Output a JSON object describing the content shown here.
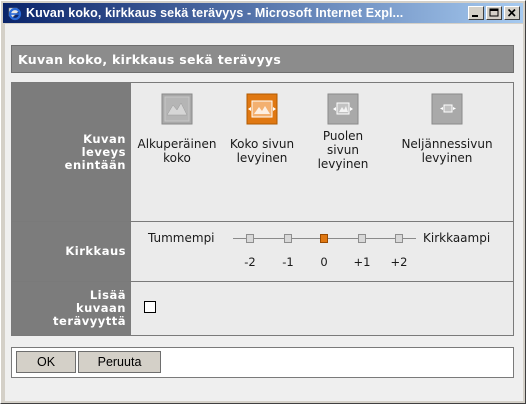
{
  "window": {
    "title": "Kuvan koko, kirkkaus sekä terävyys - Microsoft Internet Expl..."
  },
  "panel_title": "Kuvan koko, kirkkaus sekä terävyys",
  "size_row": {
    "label_lines": [
      "Kuvan",
      "leveys",
      "enintään"
    ],
    "options": [
      {
        "label_lines": [
          "Alkuperäinen",
          "koko"
        ],
        "icon": "original-size-icon",
        "selected": false
      },
      {
        "label_lines": [
          "Koko sivun",
          "levyinen"
        ],
        "icon": "full-page-width-icon",
        "selected": true
      },
      {
        "label_lines": [
          "Puolen",
          "sivun",
          "levyinen"
        ],
        "icon": "half-page-width-icon",
        "selected": false
      },
      {
        "label_lines": [
          "Neljännessivun",
          "levyinen"
        ],
        "icon": "quarter-page-width-icon",
        "selected": false
      }
    ]
  },
  "brightness_row": {
    "label": "Kirkkaus",
    "left_label": "Tummempi",
    "right_label": "Kirkkaampi",
    "ticks": [
      "-2",
      "-1",
      "0",
      "+1",
      "+2"
    ],
    "selected_value": "0"
  },
  "sharpen_row": {
    "label_lines": [
      "Lisää",
      "kuvaan",
      "terävyyttä"
    ],
    "checked": false
  },
  "buttons": {
    "ok": "OK",
    "cancel": "Peruuta"
  },
  "colors": {
    "selected_accent": "#e07812",
    "title_bar_start": "#0a246a",
    "label_cell": "#7c7c7c"
  }
}
